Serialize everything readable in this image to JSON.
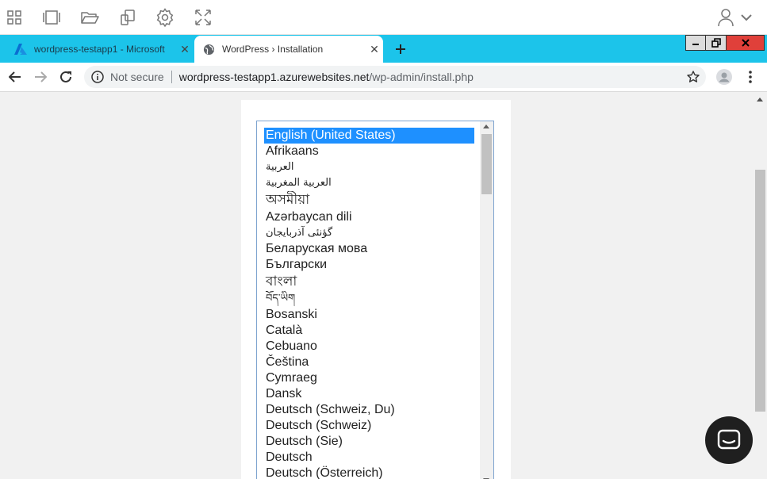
{
  "browser": {
    "tabs": [
      {
        "title": "wordpress-testapp1 - Microsoft",
        "favicon": "azure-icon",
        "active": false
      },
      {
        "title": "WordPress › Installation",
        "favicon": "globe-icon",
        "active": true
      }
    ],
    "address": {
      "security_label": "Not secure",
      "host": "wordpress-testapp1.azurewebsites.net",
      "path": "/wp-admin/install.php"
    }
  },
  "language_list": {
    "selected": "English (United States)",
    "items": [
      "English (United States)",
      "Afrikaans",
      "العربية",
      "العربية المغربية",
      "অসমীয়া",
      "Azərbaycan dili",
      "گؤنئی آذربایجان",
      "Беларуская мова",
      "Български",
      "বাংলা",
      "བོད་ཡིག",
      "Bosanski",
      "Català",
      "Cebuano",
      "Čeština",
      "Cymraeg",
      "Dansk",
      "Deutsch (Schweiz, Du)",
      "Deutsch (Schweiz)",
      "Deutsch (Sie)",
      "Deutsch",
      "Deutsch (Österreich)"
    ]
  },
  "colors": {
    "tabstrip": "#1cc4ea",
    "selection": "#1e90ff",
    "page_background": "#f1f1f1",
    "chat_bubble": "#1f1f1f",
    "close_button": "#e0403a"
  }
}
